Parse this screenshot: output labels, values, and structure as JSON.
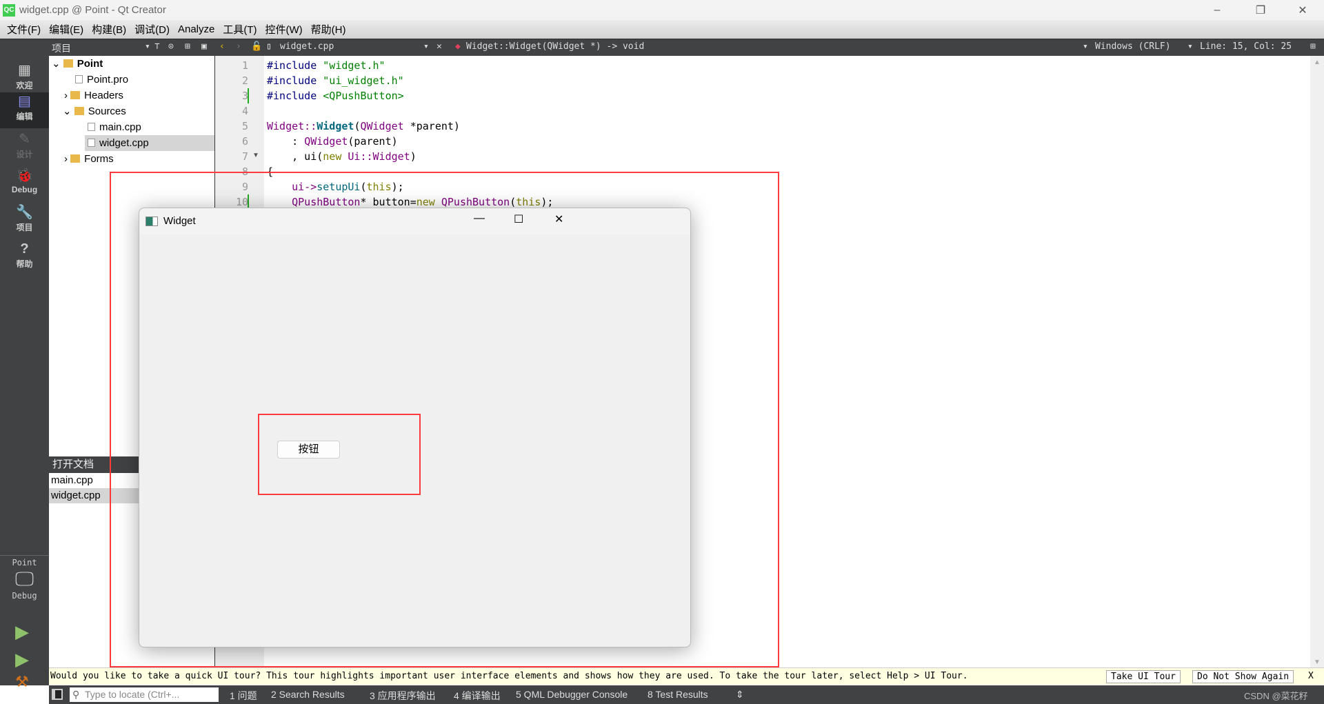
{
  "window": {
    "title": "widget.cpp @ Point - Qt Creator",
    "logo": "QC"
  },
  "menu": [
    "文件(F)",
    "编辑(E)",
    "构建(B)",
    "调试(D)",
    "Analyze",
    "工具(T)",
    "控件(W)",
    "帮助(H)"
  ],
  "toolbar": {
    "panel_title": "项目",
    "file": "widget.cpp",
    "symbol": "Widget::Widget(QWidget *) -> void",
    "line_ending": "Windows (CRLF)",
    "position": "Line: 15, Col: 25"
  },
  "modes": [
    {
      "label": "欢迎",
      "icon": "grid-icon"
    },
    {
      "label": "编辑",
      "icon": "edit-icon"
    },
    {
      "label": "设计",
      "icon": "pen-icon"
    },
    {
      "label": "Debug",
      "icon": "bug-icon"
    },
    {
      "label": "项目",
      "icon": "wrench-icon"
    },
    {
      "label": "帮助",
      "icon": "help-icon"
    }
  ],
  "kit": {
    "project": "Point",
    "build": "Debug"
  },
  "tree": [
    {
      "label": "Point",
      "bold": true
    },
    {
      "label": "Point.pro"
    },
    {
      "label": "Headers"
    },
    {
      "label": "Sources"
    },
    {
      "label": "main.cpp"
    },
    {
      "label": "widget.cpp"
    },
    {
      "label": "Forms"
    }
  ],
  "open_docs": {
    "title": "打开文档",
    "items": [
      "main.cpp",
      "widget.cpp"
    ]
  },
  "line_numbers": [
    "1",
    "2",
    "3",
    "4",
    "5",
    "6",
    "7",
    "8",
    "9",
    "10"
  ],
  "code": {
    "l1a": "#include ",
    "l1b": "\"widget.h\"",
    "l2a": "#include ",
    "l2b": "\"ui_widget.h\"",
    "l3a": "#include ",
    "l3b": "<QPushButton>",
    "l5a": "Widget::",
    "l5b": "Widget",
    "l5c": "(",
    "l5d": "QWidget",
    " l5e": "",
    "l5f": " *parent)",
    "l6a": "    : ",
    "l6b": "QWidget",
    "l6c": "(parent)",
    "l7a": "    , ui(",
    "l7b": "new ",
    "l7c": "Ui::Widget",
    "l7d": ")",
    "l8": "{",
    "l9a": "    ui->",
    "l9b": "setupUi",
    "l9c": "(",
    "l9d": "this",
    "l9e": ");",
    "l10a": "    QPushButton",
    "l10b": "* button=",
    "l10c": "new ",
    "l10d": "QPushButton",
    "l10e": "(",
    "l10f": "this",
    "l10g": ");"
  },
  "tour": {
    "message": "Would you like to take a quick UI tour? This tour highlights important user interface elements and shows how they are used. To take the tour later, select Help > UI Tour.",
    "take": "Take UI Tour",
    "dont": "Do Not Show Again",
    "close": "X"
  },
  "bottom": {
    "locate_placeholder": "Type to locate (Ctrl+...",
    "tabs": [
      "1 问题",
      "2 Search Results",
      "3 应用程序输出",
      "4 编译输出",
      "5 QML Debugger Console",
      "8 Test Results"
    ],
    "watermark": "CSDN @菜花籽"
  },
  "widget_window": {
    "title": "Widget",
    "button": "按钮"
  },
  "colors": {
    "annotation": "#ff3b3b",
    "sidebar": "#404244"
  }
}
